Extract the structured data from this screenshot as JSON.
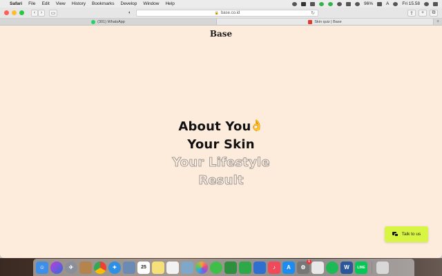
{
  "menubar": {
    "app": "Safari",
    "items": [
      "File",
      "Edit",
      "View",
      "History",
      "Bookmarks",
      "Develop",
      "Window",
      "Help"
    ],
    "battery": "96%",
    "input": "A",
    "clock": "Fri 15.58"
  },
  "toolbar": {
    "url": "base.co.id"
  },
  "tabs": [
    {
      "title": "(301) WhatsApp",
      "icon": "whatsapp-icon"
    },
    {
      "title": "Skin quiz | Base",
      "icon": "base-favicon"
    }
  ],
  "page": {
    "logo": "Base",
    "steps": [
      "About You",
      "Your Skin",
      "Your Lifestyle",
      "Result"
    ],
    "talk_button": "Talk to us"
  },
  "dock": {
    "apps": [
      "finder",
      "siri",
      "launchpad",
      "notes-app",
      "chrome",
      "safari",
      "contacts",
      "calendar",
      "stickies",
      "reminders",
      "preview",
      "photos",
      "messages",
      "facetime",
      "numbers",
      "keynote",
      "music",
      "app-store",
      "system-preferences",
      "quiz",
      "spotify",
      "word",
      "line",
      "trash"
    ],
    "calendar_day": "25",
    "badge": "1"
  }
}
